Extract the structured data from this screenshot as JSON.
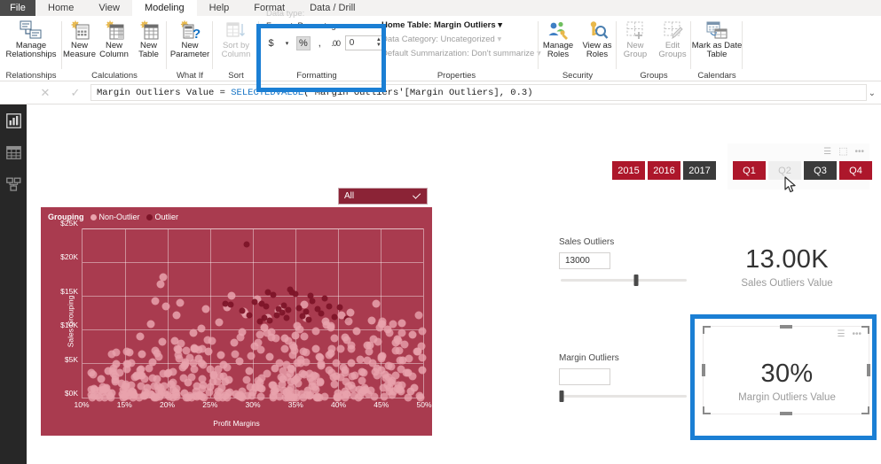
{
  "window": {
    "title": "Power BI Desktop"
  },
  "ribbon": {
    "file_tab": "File",
    "tabs": [
      {
        "label": "Home",
        "active": false
      },
      {
        "label": "View",
        "active": false
      },
      {
        "label": "Modeling",
        "active": true
      },
      {
        "label": "Help",
        "active": false
      },
      {
        "label": "Format",
        "active": false
      },
      {
        "label": "Data / Drill",
        "active": false
      }
    ],
    "groups": {
      "relationships": {
        "label": "Relationships",
        "button": "Manage Relationships",
        "icon": "manage-relationships-icon"
      },
      "calculations": {
        "label": "Calculations",
        "buttons": [
          {
            "label": "New Measure",
            "icon": "new-measure-icon"
          },
          {
            "label": "New Column",
            "icon": "new-column-icon"
          },
          {
            "label": "New Table",
            "icon": "new-table-icon"
          }
        ]
      },
      "whatif": {
        "label": "What If",
        "button": "New Parameter",
        "icon": "new-parameter-icon"
      },
      "sort": {
        "label": "Sort",
        "button": "Sort by Column",
        "icon": "sort-by-column-icon",
        "disabled": true
      },
      "formatting": {
        "label": "Formatting",
        "format_line": "Format: Percentage",
        "currency_btn": "$",
        "percent_btn": "%",
        "comma_btn": ",",
        "decimal_icon": "decimal-places-icon",
        "decimal_value": "0",
        "data_type_line": "Data type:"
      },
      "properties": {
        "label": "Properties",
        "home_table": "Home Table: Margin Outliers",
        "data_category": "Data Category: Uncategorized",
        "default_summarization": "Default Summarization: Don't summarize"
      },
      "security": {
        "label": "Security",
        "buttons": [
          {
            "label": "Manage Roles",
            "icon": "manage-roles-icon"
          },
          {
            "label": "View as Roles",
            "icon": "view-as-roles-icon"
          }
        ]
      },
      "groups_group": {
        "label": "Groups",
        "buttons": [
          {
            "label": "New Group",
            "icon": "new-group-icon"
          },
          {
            "label": "Edit Groups",
            "icon": "edit-groups-icon"
          }
        ]
      },
      "calendars": {
        "label": "Calendars",
        "button": "Mark as Date Table",
        "icon": "mark-as-date-table-icon"
      }
    }
  },
  "formula_bar": {
    "cancel_icon": "cancel-icon",
    "commit_icon": "commit-checkmark-icon",
    "measure_name": "Margin Outliers Value",
    "equals": "=",
    "function_name": "SELECTEDVALUE",
    "arguments": "('Margin Outliers'[Margin Outliers], 0.3)",
    "full_text": "Margin Outliers Value = SELECTEDVALUE('Margin Outliers'[Margin Outliers], 0.3)",
    "expand_icon": "chevron-down-icon"
  },
  "left_nav": {
    "items": [
      {
        "name": "report-view",
        "icon": "bar-chart-icon"
      },
      {
        "name": "data-view",
        "icon": "table-grid-icon"
      },
      {
        "name": "model-view",
        "icon": "relationships-icon"
      }
    ]
  },
  "canvas": {
    "filter_dropdown": {
      "value": "All",
      "icon": "chevron-down-icon"
    },
    "year_slicer": {
      "name": "year-slicer",
      "tiles": [
        {
          "label": "2015",
          "state": "normal"
        },
        {
          "label": "2016",
          "state": "normal"
        },
        {
          "label": "2017",
          "state": "selected"
        }
      ]
    },
    "quarter_slicer": {
      "name": "quarter-slicer",
      "tiles": [
        {
          "label": "Q1",
          "state": "normal"
        },
        {
          "label": "Q2",
          "state": "hover"
        },
        {
          "label": "Q3",
          "state": "selected"
        },
        {
          "label": "Q4",
          "state": "normal"
        }
      ],
      "header_icons": [
        "filter-icon",
        "focus-mode-icon",
        "more-options-icon"
      ]
    },
    "sales_param": {
      "label": "Sales Outliers",
      "value": "13000",
      "slider_percent": 60
    },
    "margin_param": {
      "label": "Margin Outliers",
      "value": "",
      "slider_percent": 1
    },
    "sales_card": {
      "value": "13.00K",
      "label": "Sales Outliers Value"
    },
    "margin_card": {
      "value": "30%",
      "label": "Margin Outliers Value",
      "selected": true,
      "header_icons": [
        "filter-icon",
        "more-options-icon"
      ]
    }
  },
  "annotations": [
    {
      "name": "formatting-group-highlight"
    },
    {
      "name": "margin-card-highlight"
    }
  ],
  "colors": {
    "chart_background": "#a93b4f",
    "outlier": "#7d1428",
    "non_outlier": "#e9a3ad",
    "slicer_red": "#ad172b",
    "slicer_selected": "#3b3b3b",
    "annotation_blue": "#1b7fd4",
    "ribbon_tab_active": "#ffffff"
  },
  "chart_data": {
    "type": "scatter",
    "title": "",
    "xlabel": "Profit Margins",
    "ylabel": "Sales Grouping",
    "legend_title": "Grouping",
    "legend_position": "top-left",
    "grid": true,
    "xlim": [
      10,
      50
    ],
    "ylim": [
      0,
      25000
    ],
    "xticks": [
      "10%",
      "15%",
      "20%",
      "25%",
      "30%",
      "35%",
      "40%",
      "45%",
      "50%"
    ],
    "xtick_values": [
      10,
      15,
      20,
      25,
      30,
      35,
      40,
      45,
      50
    ],
    "yticks": [
      "$0K",
      "$5K",
      "$10K",
      "$15K",
      "$20K",
      "$25K"
    ],
    "ytick_values": [
      0,
      5000,
      10000,
      15000,
      20000,
      25000
    ],
    "series": [
      {
        "name": "Non-Outlier",
        "color": "#e9a3ad",
        "points": [
          [
            14.6,
            2100
          ],
          [
            15.2,
            4200
          ],
          [
            15.8,
            900
          ],
          [
            16.4,
            3100
          ],
          [
            17.0,
            6400
          ],
          [
            17.6,
            1500
          ],
          [
            18.2,
            5200
          ],
          [
            18.8,
            2700
          ],
          [
            19.4,
            8300
          ],
          [
            20.0,
            3600
          ],
          [
            20.6,
            1200
          ],
          [
            21.2,
            7100
          ],
          [
            21.8,
            4500
          ],
          [
            22.4,
            2300
          ],
          [
            23.0,
            9600
          ],
          [
            23.6,
            5800
          ],
          [
            24.2,
            1800
          ],
          [
            24.8,
            6900
          ],
          [
            25.4,
            3300
          ],
          [
            26.0,
            11200
          ],
          [
            26.6,
            4900
          ],
          [
            27.2,
            2600
          ],
          [
            27.8,
            8100
          ],
          [
            28.4,
            5400
          ],
          [
            29.0,
            12700
          ],
          [
            29.6,
            3900
          ],
          [
            30.2,
            7600
          ],
          [
            30.8,
            2200
          ],
          [
            31.4,
            10400
          ],
          [
            32.0,
            6100
          ],
          [
            32.6,
            4300
          ],
          [
            33.2,
            13100
          ],
          [
            33.8,
            8800
          ],
          [
            34.4,
            3500
          ],
          [
            35.0,
            9200
          ],
          [
            35.6,
            5700
          ],
          [
            36.2,
            11900
          ],
          [
            36.8,
            2900
          ],
          [
            37.4,
            7300
          ],
          [
            38.0,
            4700
          ],
          [
            38.6,
            10800
          ],
          [
            39.2,
            6600
          ],
          [
            39.8,
            3200
          ],
          [
            40.4,
            12300
          ],
          [
            41.0,
            8500
          ],
          [
            41.6,
            5100
          ],
          [
            42.2,
            9900
          ],
          [
            42.8,
            3800
          ],
          [
            43.4,
            7800
          ],
          [
            44.0,
            11500
          ],
          [
            44.6,
            4400
          ],
          [
            45.2,
            6200
          ],
          [
            45.8,
            10100
          ],
          [
            46.4,
            2500
          ],
          [
            47.0,
            8700
          ],
          [
            47.6,
            5500
          ],
          [
            48.2,
            3700
          ],
          [
            48.8,
            9400
          ],
          [
            49.4,
            6800
          ],
          [
            49.9,
            4100
          ],
          [
            13.4,
            600
          ],
          [
            12.8,
            1400
          ],
          [
            16.0,
            400
          ],
          [
            19.0,
            1000
          ],
          [
            22.0,
            700
          ],
          [
            25.0,
            1600
          ],
          [
            28.0,
            500
          ],
          [
            31.0,
            1300
          ],
          [
            34.0,
            800
          ],
          [
            37.0,
            1700
          ],
          [
            40.0,
            600
          ],
          [
            43.0,
            1100
          ],
          [
            46.0,
            900
          ],
          [
            49.0,
            1500
          ],
          [
            17.2,
            300
          ],
          [
            20.4,
            2000
          ],
          [
            23.8,
            450
          ],
          [
            26.8,
            2400
          ],
          [
            30.0,
            850
          ],
          [
            33.5,
            2800
          ],
          [
            36.5,
            1050
          ],
          [
            39.5,
            3000
          ],
          [
            42.5,
            1250
          ],
          [
            45.5,
            3400
          ],
          [
            48.5,
            950
          ],
          [
            18.5,
            14300
          ],
          [
            19.2,
            16900
          ],
          [
            19.5,
            17900
          ],
          [
            19.8,
            13600
          ],
          [
            21.5,
            14100
          ],
          [
            24.5,
            13100
          ],
          [
            27.5,
            15100
          ],
          [
            29.2,
            12400
          ],
          [
            31.8,
            11800
          ],
          [
            35.2,
            10600
          ],
          [
            14.0,
            5000
          ],
          [
            16.8,
            9100
          ],
          [
            21.0,
            12200
          ],
          [
            24.0,
            10300
          ],
          [
            27.0,
            13400
          ],
          [
            30.5,
            14600
          ],
          [
            33.0,
            12900
          ],
          [
            36.0,
            13800
          ],
          [
            38.5,
            11300
          ],
          [
            41.5,
            12600
          ],
          [
            44.5,
            13900
          ],
          [
            47.5,
            11000
          ],
          [
            12.2,
            2800
          ],
          [
            13.0,
            3900
          ],
          [
            15.5,
            6700
          ],
          [
            18.0,
            10900
          ],
          [
            20.8,
            8400
          ],
          [
            23.2,
            7200
          ],
          [
            26.2,
            6300
          ],
          [
            28.8,
            9700
          ],
          [
            32.2,
            8900
          ],
          [
            34.8,
            7500
          ],
          [
            37.8,
            6000
          ],
          [
            40.8,
            9000
          ],
          [
            43.8,
            7700
          ],
          [
            46.8,
            8200
          ]
        ]
      },
      {
        "name": "Outlier",
        "color": "#7d1428",
        "points": [
          [
            29.3,
            22700
          ],
          [
            31.8,
            15600
          ],
          [
            32.4,
            15200
          ],
          [
            34.6,
            15700
          ],
          [
            35.0,
            15400
          ],
          [
            36.8,
            15100
          ],
          [
            38.4,
            14800
          ],
          [
            30.2,
            14200
          ],
          [
            31.0,
            13900
          ],
          [
            31.6,
            13500
          ],
          [
            33.0,
            13200
          ],
          [
            33.6,
            13700
          ],
          [
            34.2,
            13000
          ],
          [
            35.4,
            13300
          ],
          [
            36.2,
            12800
          ],
          [
            37.0,
            14400
          ],
          [
            37.6,
            13100
          ],
          [
            38.0,
            12500
          ],
          [
            39.0,
            13600
          ],
          [
            32.8,
            12200
          ],
          [
            33.4,
            12600
          ],
          [
            34.0,
            11900
          ],
          [
            35.8,
            12100
          ],
          [
            36.6,
            11600
          ],
          [
            30.8,
            11300
          ],
          [
            31.4,
            11800
          ],
          [
            32.0,
            11500
          ],
          [
            28.8,
            12900
          ],
          [
            29.6,
            12300
          ],
          [
            39.6,
            12000
          ],
          [
            40.2,
            13400
          ],
          [
            27.4,
            13800
          ],
          [
            26.8,
            14000
          ],
          [
            41.0,
            11700
          ],
          [
            34.4,
            16100
          ]
        ]
      }
    ]
  }
}
